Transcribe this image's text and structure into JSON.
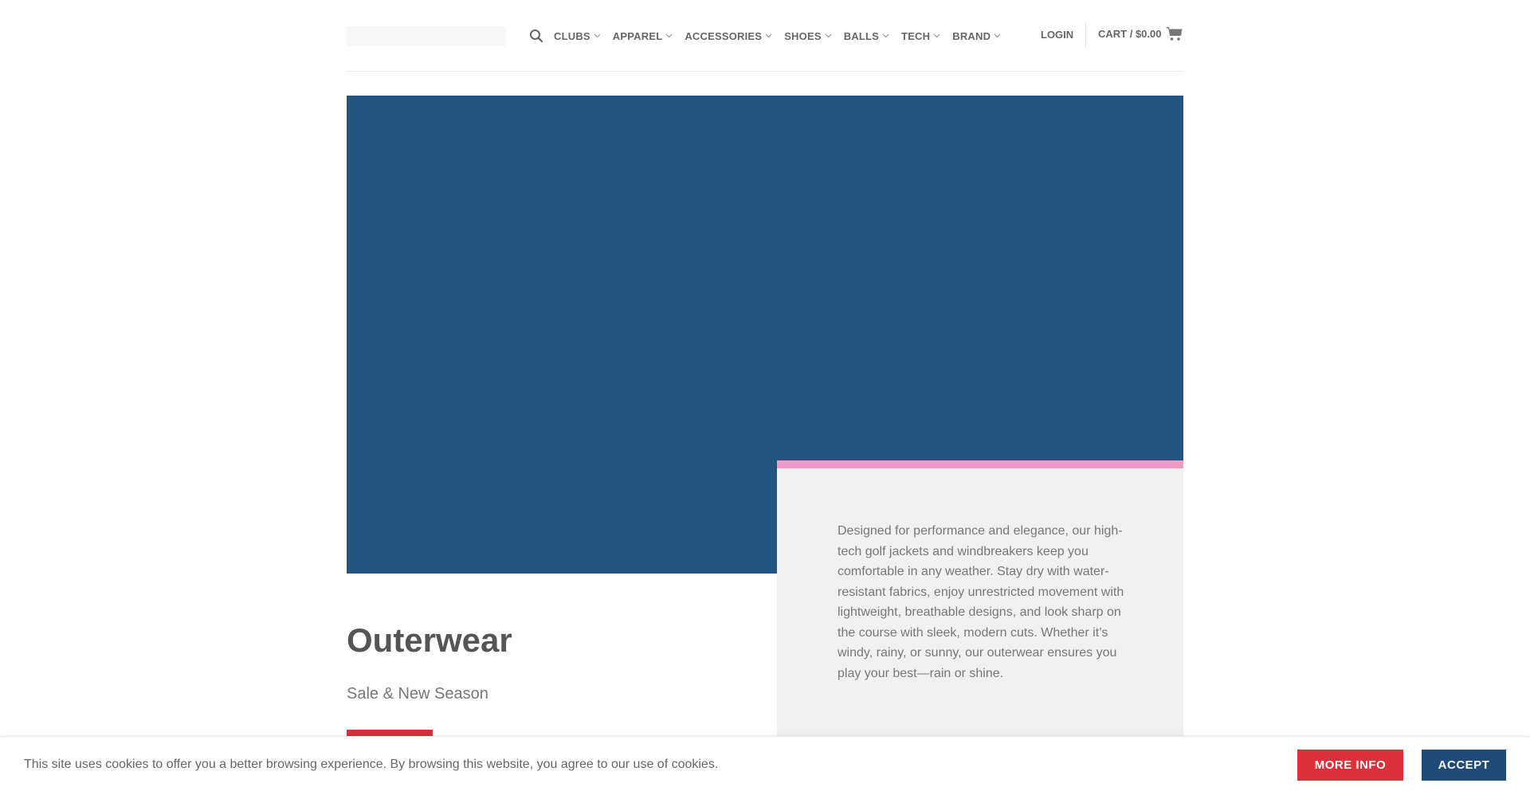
{
  "header": {
    "logo_icon": "logo-placeholder",
    "search_icon": "search-icon",
    "nav": [
      {
        "label": "CLUBS"
      },
      {
        "label": "APPAREL"
      },
      {
        "label": "ACCESSORIES"
      },
      {
        "label": "SHOES"
      },
      {
        "label": "BALLS"
      },
      {
        "label": "TECH"
      },
      {
        "label": "BRAND"
      }
    ],
    "login_label": "LOGIN",
    "cart_label": "CART / $0.00",
    "cart_icon": "shopping-cart-icon"
  },
  "hero": {
    "background_color": "#23547d"
  },
  "info_card": {
    "accent_color": "#f29ac5",
    "description": "Designed for performance and elegance, our high-tech golf jackets and windbreakers keep you comfortable in any weather. Stay dry with water-resistant fabrics, enjoy unrestricted movement with lightweight, breathable designs, and look sharp on the course with sleek, modern cuts. Whether it’s windy, rainy, or sunny, our outerwear ensures you play your best—rain or shine."
  },
  "category": {
    "title": "Outerwear",
    "subtitle": "Sale & New Season",
    "cta_color": "#d6323d"
  },
  "cookie_bar": {
    "message": "This site uses cookies to offer you a better browsing experience. By browsing this website, you agree to our use of cookies.",
    "more_info_label": "MORE INFO",
    "accept_label": "ACCEPT",
    "more_info_color": "#de3039",
    "accept_color": "#1f4b78"
  }
}
